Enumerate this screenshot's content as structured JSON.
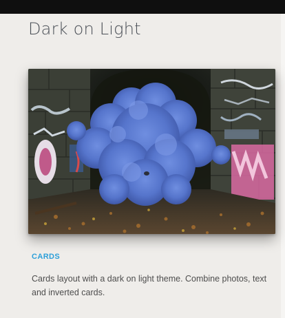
{
  "page": {
    "title": "Dark on Light"
  },
  "card": {
    "image_alt": "blue smoke cloud in graffiti tunnel",
    "label": "CARDS",
    "description": "Cards layout with a dark on light theme. Combine photos, text and inverted cards."
  },
  "colors": {
    "background": "#efedea",
    "top_bar": "#0f0f0f",
    "accent": "#2b9fd9",
    "smoke": "#5a7ad0"
  }
}
